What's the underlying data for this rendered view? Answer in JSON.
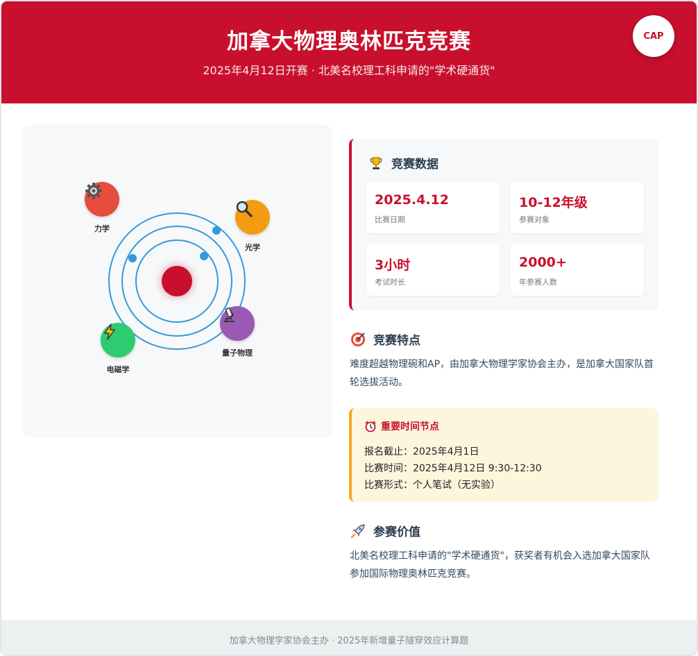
{
  "header": {
    "title": "加拿大物理奥林匹克竞赛",
    "subtitle": "2025年4月12日开赛 · 北美名校理工科申请的\"学术硬通货\"",
    "badge": "CAP"
  },
  "diagram": {
    "nodes": [
      {
        "label": "力学",
        "icon": "gear-icon",
        "color": "#e74c3c"
      },
      {
        "label": "光学",
        "icon": "magnifier-icon",
        "color": "#f39c12"
      },
      {
        "label": "量子物理",
        "icon": "microscope-icon",
        "color": "#9b59b6"
      },
      {
        "label": "电磁学",
        "icon": "lightning-icon",
        "color": "#2ecc71"
      }
    ],
    "nucleus_color": "#c8102e",
    "orbit_color": "#3498db"
  },
  "stats": {
    "title": "竞赛数据",
    "icon": "trophy-icon",
    "cards": [
      {
        "value": "2025.4.12",
        "label": "比赛日期"
      },
      {
        "value": "10-12年级",
        "label": "参赛对象"
      },
      {
        "value": "3小时",
        "label": "考试时长"
      },
      {
        "value": "2000+",
        "label": "年参赛人数"
      }
    ]
  },
  "features": {
    "title": "竞赛特点",
    "icon": "target-icon",
    "text": "难度超越物理碗和AP，由加拿大物理学家协会主办，是加拿大国家队首轮选拔活动。"
  },
  "timeline": {
    "title": "重要时间节点",
    "icon": "alarm-clock-icon",
    "rows": [
      "报名截止：2025年4月1日",
      "比赛时间：2025年4月12日 9:30-12:30",
      "比赛形式：个人笔试（无实验）"
    ]
  },
  "value": {
    "title": "参赛价值",
    "icon": "rocket-icon",
    "text": "北美名校理工科申请的\"学术硬通货\"，获奖者有机会入选加拿大国家队参加国际物理奥林匹克竞赛。"
  },
  "footer": {
    "text": "加拿大物理学家协会主办 · 2025年新增量子隧穿效应计算题"
  },
  "colors": {
    "brand_red": "#c8102e",
    "accent_orange": "#f5a623",
    "text_dark": "#2c3e50"
  }
}
